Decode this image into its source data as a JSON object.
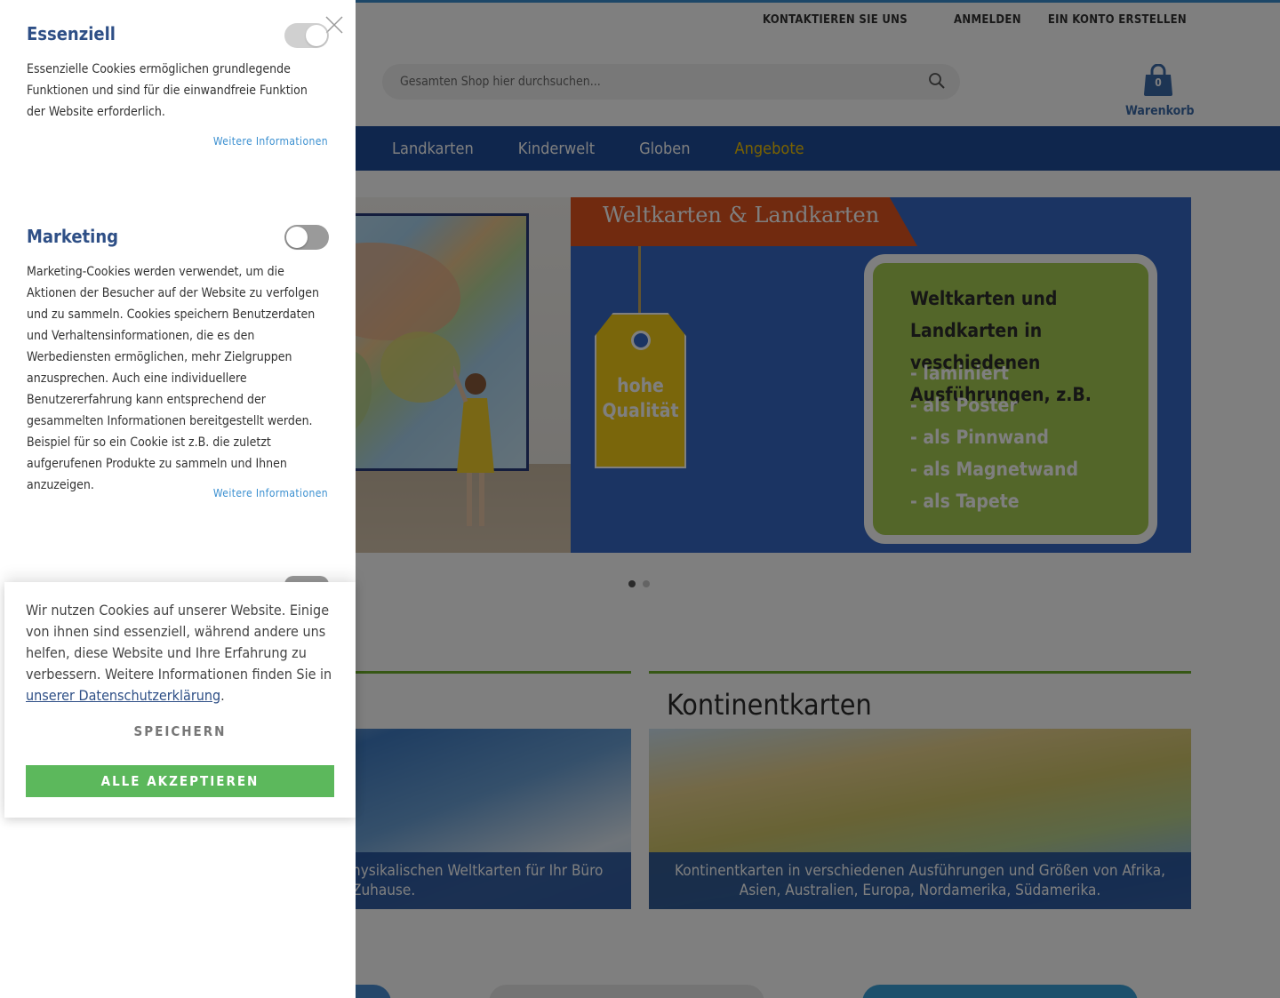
{
  "header": {
    "top_links": [
      "KONTAKTIEREN SIE UNS",
      "ANMELDEN",
      "EIN KONTO ERSTELLEN"
    ],
    "search_placeholder": "Gesamten Shop hier durchsuchen...",
    "cart_count": "0",
    "cart_label": "Warenkorb"
  },
  "nav": {
    "items": [
      "Landkarten",
      "Kinderwelt",
      "Globen",
      "Angebote"
    ]
  },
  "hero": {
    "ribbon": "Weltkarten & Landkarten",
    "tag_line1": "hohe",
    "tag_line2": "Qualität",
    "board_heading": "Weltkarten und Landkarten in veschiedenen  Ausführungen, z.B.",
    "board_items": [
      "- laminiert",
      "- als Poster",
      "- als Pinnwand",
      "- als Magnetwand",
      "- als Tapete"
    ]
  },
  "cards": [
    {
      "title": "",
      "caption": "hysikalischen Weltkarten für Ihr Büro\nZuhause."
    },
    {
      "title": "Kontinentkarten",
      "caption": "Kontinentkarten in verschiedenen Ausführungen und Größen von Afrika, Asien, Australien, Europa, Nordamerika, Südamerika."
    }
  ],
  "cookie_panel": {
    "essential": {
      "title": "Essenziell",
      "text": "Essenzielle Cookies ermöglichen grundlegende Funktionen und sind für die einwandfreie Funktion der Website erforderlich.",
      "more": "Weitere Informationen",
      "enabled": true
    },
    "marketing": {
      "title": "Marketing",
      "text": "Marketing-Cookies werden verwendet, um die Aktionen der Besucher auf der Website zu verfolgen und zu sammeln. Cookies speichern Benutzerdaten und Verhaltensinformationen, die es den Werbediensten ermöglichen, mehr Zielgruppen anzusprechen. Auch eine individuellere Benutzererfahrung kann entsprechend der gesammelten Informationen bereitgestellt werden. Beispiel für so ein Cookie ist z.B. die zuletzt aufgerufenen Produkte zu sammeln und Ihnen anzuzeigen.",
      "more": "Weitere Informationen",
      "enabled": false
    }
  },
  "cookie_banner": {
    "message": "Wir nutzen Cookies auf unserer Website. Einige von ihnen sind essenziell, während andere uns helfen, diese Website und Ihre Erfahrung zu verbessern. Weitere Informationen finden Sie in ",
    "link": "unserer Datenschutzerklärung",
    "message_end": ".",
    "save_label": "SPEICHERN",
    "accept_label": "ALLE AKZEPTIEREN"
  },
  "colors": {
    "accent_blue": "#2e4f86",
    "link_blue": "#3a8fd0",
    "accept_green": "#5cb85c",
    "nav_blue": "#1f4d9a",
    "offer_yellow": "#f5c400"
  }
}
